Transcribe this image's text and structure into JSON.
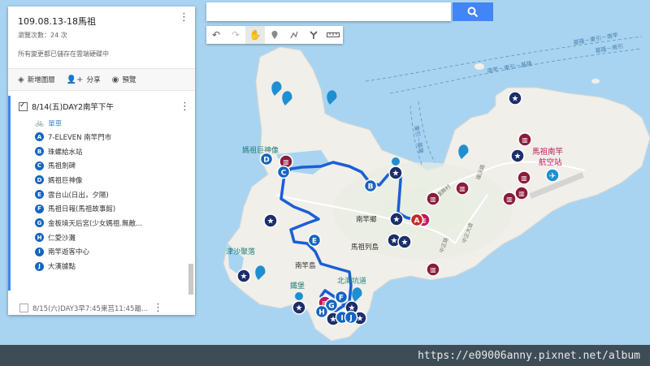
{
  "panel": {
    "title": "109.08.13-18馬祖",
    "views": "瀏覽次數：24 次",
    "saved": "所有變更都已儲存在雲端硬碟中",
    "actions": [
      {
        "icon": "layers-icon",
        "label": "新增圖層"
      },
      {
        "icon": "add-person-icon",
        "label": "分享"
      },
      {
        "icon": "eye-icon",
        "label": "預覽"
      }
    ],
    "layer1": {
      "title": "8/14(五)DAY2南竿下午",
      "style_label": "單車",
      "items": [
        {
          "badge": "A",
          "label": "7-ELEVEN 南竿門市"
        },
        {
          "badge": "B",
          "label": "珠螺給水站"
        },
        {
          "badge": "C",
          "label": "馬祖劍碑"
        },
        {
          "badge": "D",
          "label": "媽祖巨神像"
        },
        {
          "badge": "E",
          "label": "雲台山(日出，夕陽)"
        },
        {
          "badge": "F",
          "label": "馬祖日報(馬祖故事館)"
        },
        {
          "badge": "G",
          "label": "金板境天后宮(少女媽祖.無敵..."
        },
        {
          "badge": "H",
          "label": "仁愛沙灘"
        },
        {
          "badge": "I",
          "label": "南竿遊客中心"
        },
        {
          "badge": "J",
          "label": "大漢據點"
        }
      ]
    },
    "layer2": {
      "title": "8/15(六)DAY3早7:45東莒11:45離..."
    }
  },
  "search": {
    "value": "",
    "button_icon": "search-icon"
  },
  "toolbar": {
    "tools": [
      "undo-icon",
      "redo-icon",
      "hand-icon",
      "marker-icon",
      "line-icon",
      "directions-icon",
      "ruler-icon"
    ]
  },
  "map": {
    "labels": {
      "mazu_statue": "媽祖巨神像",
      "nangan_township": "南竿鄉",
      "mazu_islands": "馬祖列島",
      "nangan_island": "南竿島",
      "jinsha_village": "津沙聚落",
      "tiebao": "鐵堡",
      "beihai_tunnel": "北海坑道",
      "airport_l1": "馬祖南竿",
      "airport_l2": "航空站",
      "ferry1": "基隆－東引－南竿",
      "ferry2": "基隆－南引",
      "ferry3": "南竿－東引－基隆",
      "ferry4": "東引－基隆",
      "road1": "福沃路",
      "road2": "復興村",
      "road3": "中正路",
      "road4": "中正大道"
    },
    "markers": {
      "a": "A",
      "b": "B",
      "c": "C",
      "d": "D",
      "e": "E",
      "f": "F",
      "g": "G",
      "h": "H",
      "i": "I",
      "j": "J"
    },
    "colors": {
      "water": "#a9d4f1",
      "land": "#f1f0eb",
      "route": "#1a5fd6",
      "marker": "#1565c0",
      "navy": "#1b2d6b",
      "maroon": "#8a1b3a",
      "teal": "#1f8fd1"
    }
  },
  "footer": {
    "watermark": "https://e09006anny.pixnet.net/album"
  }
}
